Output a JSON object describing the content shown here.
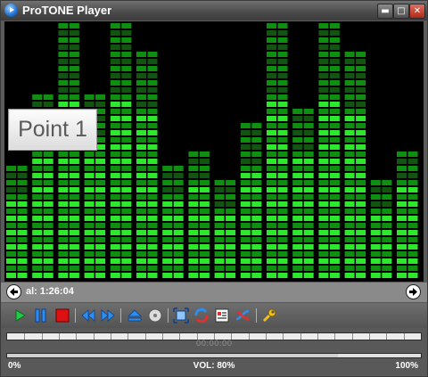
{
  "window": {
    "title": "ProTONE Player"
  },
  "titlebar_buttons": {
    "minimize": "▬",
    "maximize": "□",
    "close": "✕"
  },
  "visualizer": {
    "badge": "Point 1",
    "levels": [
      6,
      11,
      16,
      11,
      16,
      14,
      6,
      7,
      5,
      9,
      16,
      10,
      16,
      14,
      5,
      7
    ]
  },
  "info": {
    "text": "al: 1:26:04"
  },
  "toolbar": {
    "items": [
      "play-icon",
      "pause-icon",
      "stop-icon",
      "rewind-icon",
      "fast-forward-icon",
      "eject-icon",
      "disc-icon",
      "fullscreen-icon",
      "refresh-icon",
      "playlist-icon",
      "shuffle-icon",
      "settings-icon"
    ]
  },
  "seek": {
    "time_label": "00:00:00"
  },
  "volume": {
    "min_label": "0%",
    "label": "VOL: 80%",
    "max_label": "100%",
    "level": 0.8
  },
  "colors": {
    "accent_green": "#33ff33",
    "stop_red": "#dd1111",
    "icon_blue": "#3399ff"
  }
}
